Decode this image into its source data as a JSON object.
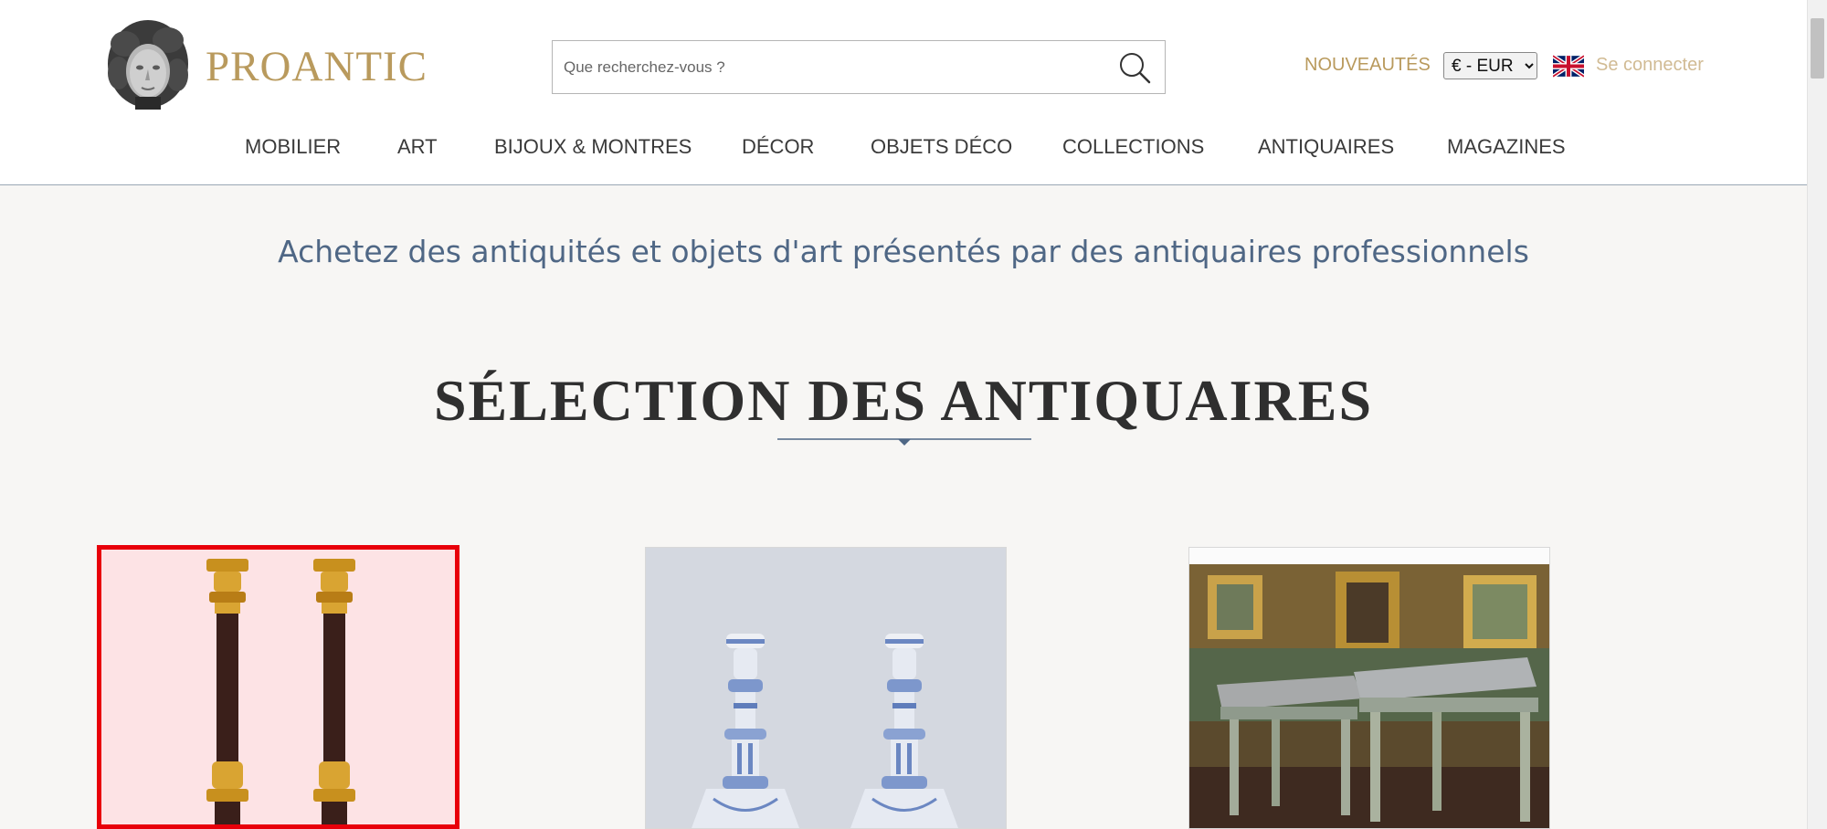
{
  "header": {
    "brand": "PROANTIC",
    "search": {
      "placeholder": "Que recherchez-vous ?",
      "value": ""
    },
    "nouveautes_label": "NOUVEAUTÉS",
    "currency": {
      "selected": "€ - EUR",
      "options": [
        "€ - EUR"
      ]
    },
    "language_flag": "uk-flag-icon",
    "login_label": "Se connecter"
  },
  "nav": {
    "items": [
      {
        "label": "MOBILIER"
      },
      {
        "label": "ART"
      },
      {
        "label": "BIJOUX & MONTRES"
      },
      {
        "label": "DÉCOR"
      },
      {
        "label": "OBJETS DÉCO"
      },
      {
        "label": "COLLECTIONS"
      },
      {
        "label": "ANTIQUAIRES"
      },
      {
        "label": "MAGAZINES"
      }
    ]
  },
  "main": {
    "tagline": "Achetez des antiquités et objets d'art présentés par des antiquaires professionnels",
    "section_title": "SÉLECTION DES ANTIQUAIRES",
    "products": [
      {
        "image": "gilt-bronze-candlesticks-photo",
        "highlighted": true
      },
      {
        "image": "blue-white-faience-candlesticks-photo",
        "highlighted": false
      },
      {
        "image": "louis-xvi-stools-photo",
        "highlighted": false
      }
    ]
  },
  "colors": {
    "brand_gold": "#b99a5d",
    "login_gold": "#d1bb94",
    "tagline_blue": "#4f6785",
    "highlight_red": "#e8000a",
    "page_bg": "#f7f6f4"
  }
}
